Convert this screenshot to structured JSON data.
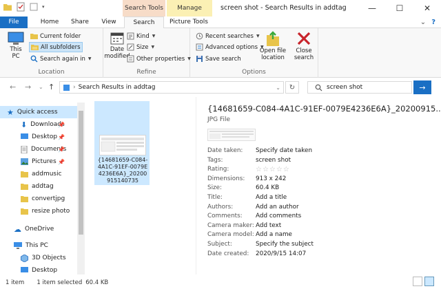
{
  "window": {
    "title": "screen shot - Search Results in addtag",
    "context_tab_search": "Search Tools",
    "context_tab_manage": "Manage"
  },
  "ribbon_tabs": {
    "file": "File",
    "home": "Home",
    "share": "Share",
    "view": "View",
    "search": "Search",
    "picture_tools": "Picture Tools"
  },
  "ribbon": {
    "location": {
      "this_pc": "This\nPC",
      "current_folder": "Current folder",
      "all_subfolders": "All subfolders",
      "search_again": "Search again in",
      "label": "Location"
    },
    "refine": {
      "date_modified": "Date\nmodified",
      "kind": "Kind",
      "size": "Size",
      "other_properties": "Other properties",
      "label": "Refine"
    },
    "options": {
      "recent_searches": "Recent searches",
      "advanced_options": "Advanced options",
      "save_search": "Save search",
      "open_file_location": "Open file\nlocation",
      "close_search": "Close\nsearch",
      "label": "Options"
    }
  },
  "address": {
    "path": "Search Results in addtag",
    "search_query": "screen shot"
  },
  "nav": {
    "quick_access": "Quick access",
    "items": [
      {
        "label": "Downloads",
        "pinned": true
      },
      {
        "label": "Desktop",
        "pinned": true
      },
      {
        "label": "Documents",
        "pinned": true
      },
      {
        "label": "Pictures",
        "pinned": true
      },
      {
        "label": "addmusic",
        "pinned": false
      },
      {
        "label": "addtag",
        "pinned": false
      },
      {
        "label": "convertjpg",
        "pinned": false
      },
      {
        "label": "resize photo",
        "pinned": false
      }
    ],
    "onedrive": "OneDrive",
    "this_pc": "This PC",
    "objects3d": "3D Objects",
    "desktop2": "Desktop"
  },
  "file": {
    "name": "{14681659-C084-4A1C-91EF-0079E4236E6A}_20200915140735"
  },
  "details": {
    "title": "{14681659-C084-4A1C-91EF-0079E4236E6A}_20200915...",
    "type": "JPG File",
    "props": [
      {
        "key": "Date taken:",
        "value": "Specify date taken"
      },
      {
        "key": "Tags:",
        "value": "screen shot"
      },
      {
        "key": "Rating:",
        "value": "☆☆☆☆☆"
      },
      {
        "key": "Dimensions:",
        "value": "913 x 242"
      },
      {
        "key": "Size:",
        "value": "60.4 KB"
      },
      {
        "key": "Title:",
        "value": "Add a title"
      },
      {
        "key": "Authors:",
        "value": "Add an author"
      },
      {
        "key": "Comments:",
        "value": "Add comments"
      },
      {
        "key": "Camera maker:",
        "value": "Add text"
      },
      {
        "key": "Camera model:",
        "value": "Add a name"
      },
      {
        "key": "Subject:",
        "value": "Specify the subject"
      },
      {
        "key": "Date created:",
        "value": "2020/9/15 14:07"
      }
    ]
  },
  "status": {
    "count": "1 item",
    "selected": "1 item selected",
    "size": "60.4 KB"
  },
  "colors": {
    "accent": "#1a6fc4",
    "selection": "#cce8ff",
    "search_context": "#f7dcc8",
    "manage_context": "#fbf0b4"
  }
}
